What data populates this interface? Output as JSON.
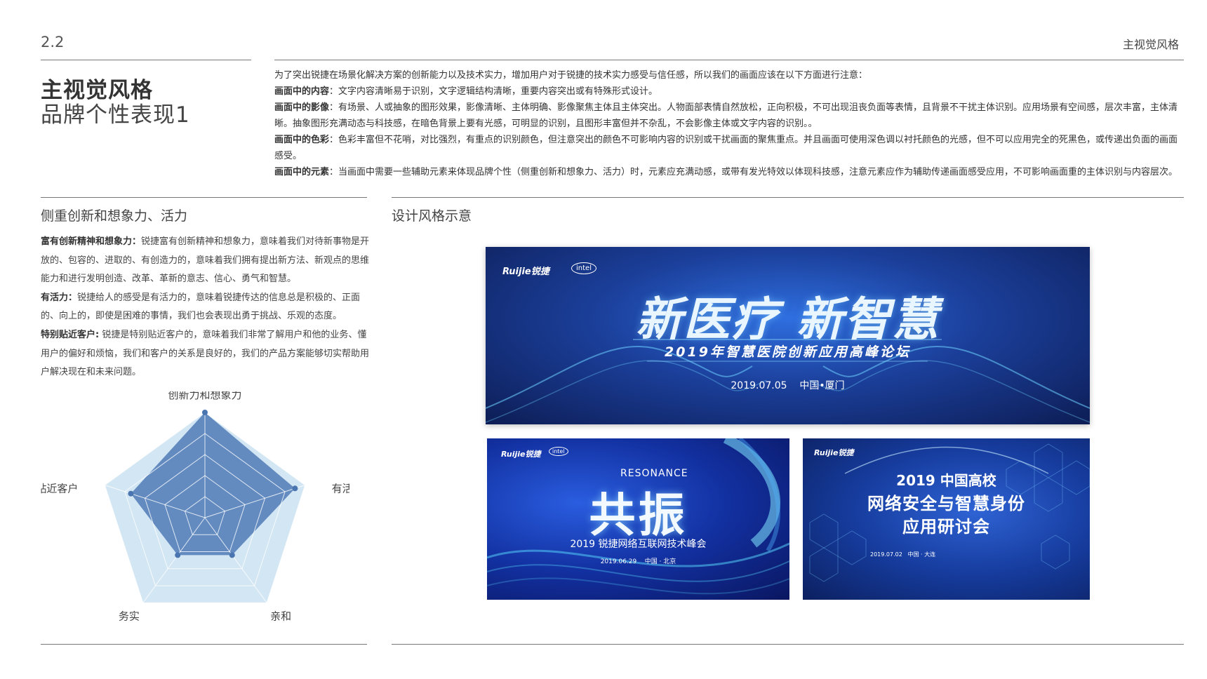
{
  "header": {
    "page_number": "2.2",
    "section_label": "主视觉风格"
  },
  "title": {
    "main": "主视觉风格",
    "sub": "品牌个性表现1"
  },
  "intro": {
    "lead": "为了突出锐捷在场景化解决方案的创新能力以及技术实力，增加用户对于锐捷的技术实力感受与信任感，所以我们的画面应该在以下方面进行注意：",
    "items": [
      {
        "label": "画面中的内容",
        "text": "：文字内容清晰易于识别，文字逻辑结构清晰，重要内容突出或有特殊形式设计。"
      },
      {
        "label": "画面中的影像",
        "text": "：有场景、人或抽象的图形效果，影像清晰、主体明确、影像聚焦主体且主体突出。人物面部表情自然放松，正向积极，不可出现沮丧负面等表情，且背景不干扰主体识别。应用场景有空间感，层次丰富，主体清晰。抽象图形充满动态与科技感，在暗色背景上要有光感，可明显的识别，且图形丰富但并不杂乱，不会影像主体或文字内容的识别。。"
      },
      {
        "label": "画面中的色彩",
        "text": "：色彩丰富但不花哨，对比强烈，有重点的识别颜色，但注意突出的颜色不可影响内容的识别或干扰画面的聚焦重点。并且画面可使用深色调以衬托颜色的光感，但不可以应用完全的死黑色，或传递出负面的画面感受。"
      },
      {
        "label": "画面中的元素",
        "text": "：当画面中需要一些辅助元素来体现品牌个性（侧重创新和想象力、活力）时，元素应充满动感，或带有发光特效以体现科技感，注意元素应作为辅助传递画面感受应用，不可影响画面重的主体识别与内容层次。"
      }
    ]
  },
  "left": {
    "heading": "侧重创新和想象力、活力",
    "traits": [
      {
        "label": "富有创新精神和想象力：",
        "text": "锐捷富有创新精神和想象力，意味着我们对待新事物是开放的、包容的、进取的、有创造力的，意味着我们拥有提出新方法、新观点的思维能力和进行发明创造、改革、革新的意志、信心、勇气和智慧。"
      },
      {
        "label": "有活力：",
        "text": "锐捷给人的感受是有活力的，意味着锐捷传达的信息总是积极的、正面的、向上的，即使是困难的事情，我们也会表现出勇于挑战、乐观的态度。"
      },
      {
        "label": "特别贴近客户:",
        "text": " 锐捷是特别贴近客户的，意味着我们非常了解用户和他的业务、懂用户的偏好和烦恼，我们和客户的关系是良好的，我们的产品方案能够切实帮助用户解决现在和未来问题。"
      }
    ]
  },
  "chart_data": {
    "type": "radar",
    "axes": [
      "创新力和想象力",
      "有活力",
      "亲和",
      "务实",
      "贴近客户"
    ],
    "max": 5,
    "values": [
      5,
      4.5,
      2.2,
      2.2,
      3.7
    ],
    "levels": 5,
    "colors": {
      "background": "#d3e6f3",
      "fill": "#5d86bd",
      "grid": "#ffffff",
      "point": "#4a75b0"
    }
  },
  "right": {
    "heading": "设计风格示意",
    "banners": [
      {
        "logo": "Ruijie锐捷",
        "partner_logo": "intel",
        "headline": "新医疗 新智慧",
        "subtitle": "2019年智慧医院创新应用高峰论坛",
        "date": "2019.07.05",
        "location": "中国•厦门"
      },
      {
        "logo": "Ruijie锐捷",
        "partner_logo": "intel",
        "eyebrow": "RESONANCE",
        "headline": "共振",
        "subtitle": "2019 锐捷网络互联网技术峰会",
        "date": "2019.06.29",
        "location": "中国 · 北京"
      },
      {
        "logo": "Ruijie锐捷",
        "line1": "2019 中国高校",
        "line2": "网络安全与智慧身份",
        "line3": "应用研讨会",
        "date": "2019.07.02",
        "location": "中国 · 大连"
      }
    ]
  },
  "colors": {
    "rule": "#777777",
    "text": "#333333",
    "banner_blue": "#1b3f9a",
    "glow": "#6fd6ff"
  }
}
